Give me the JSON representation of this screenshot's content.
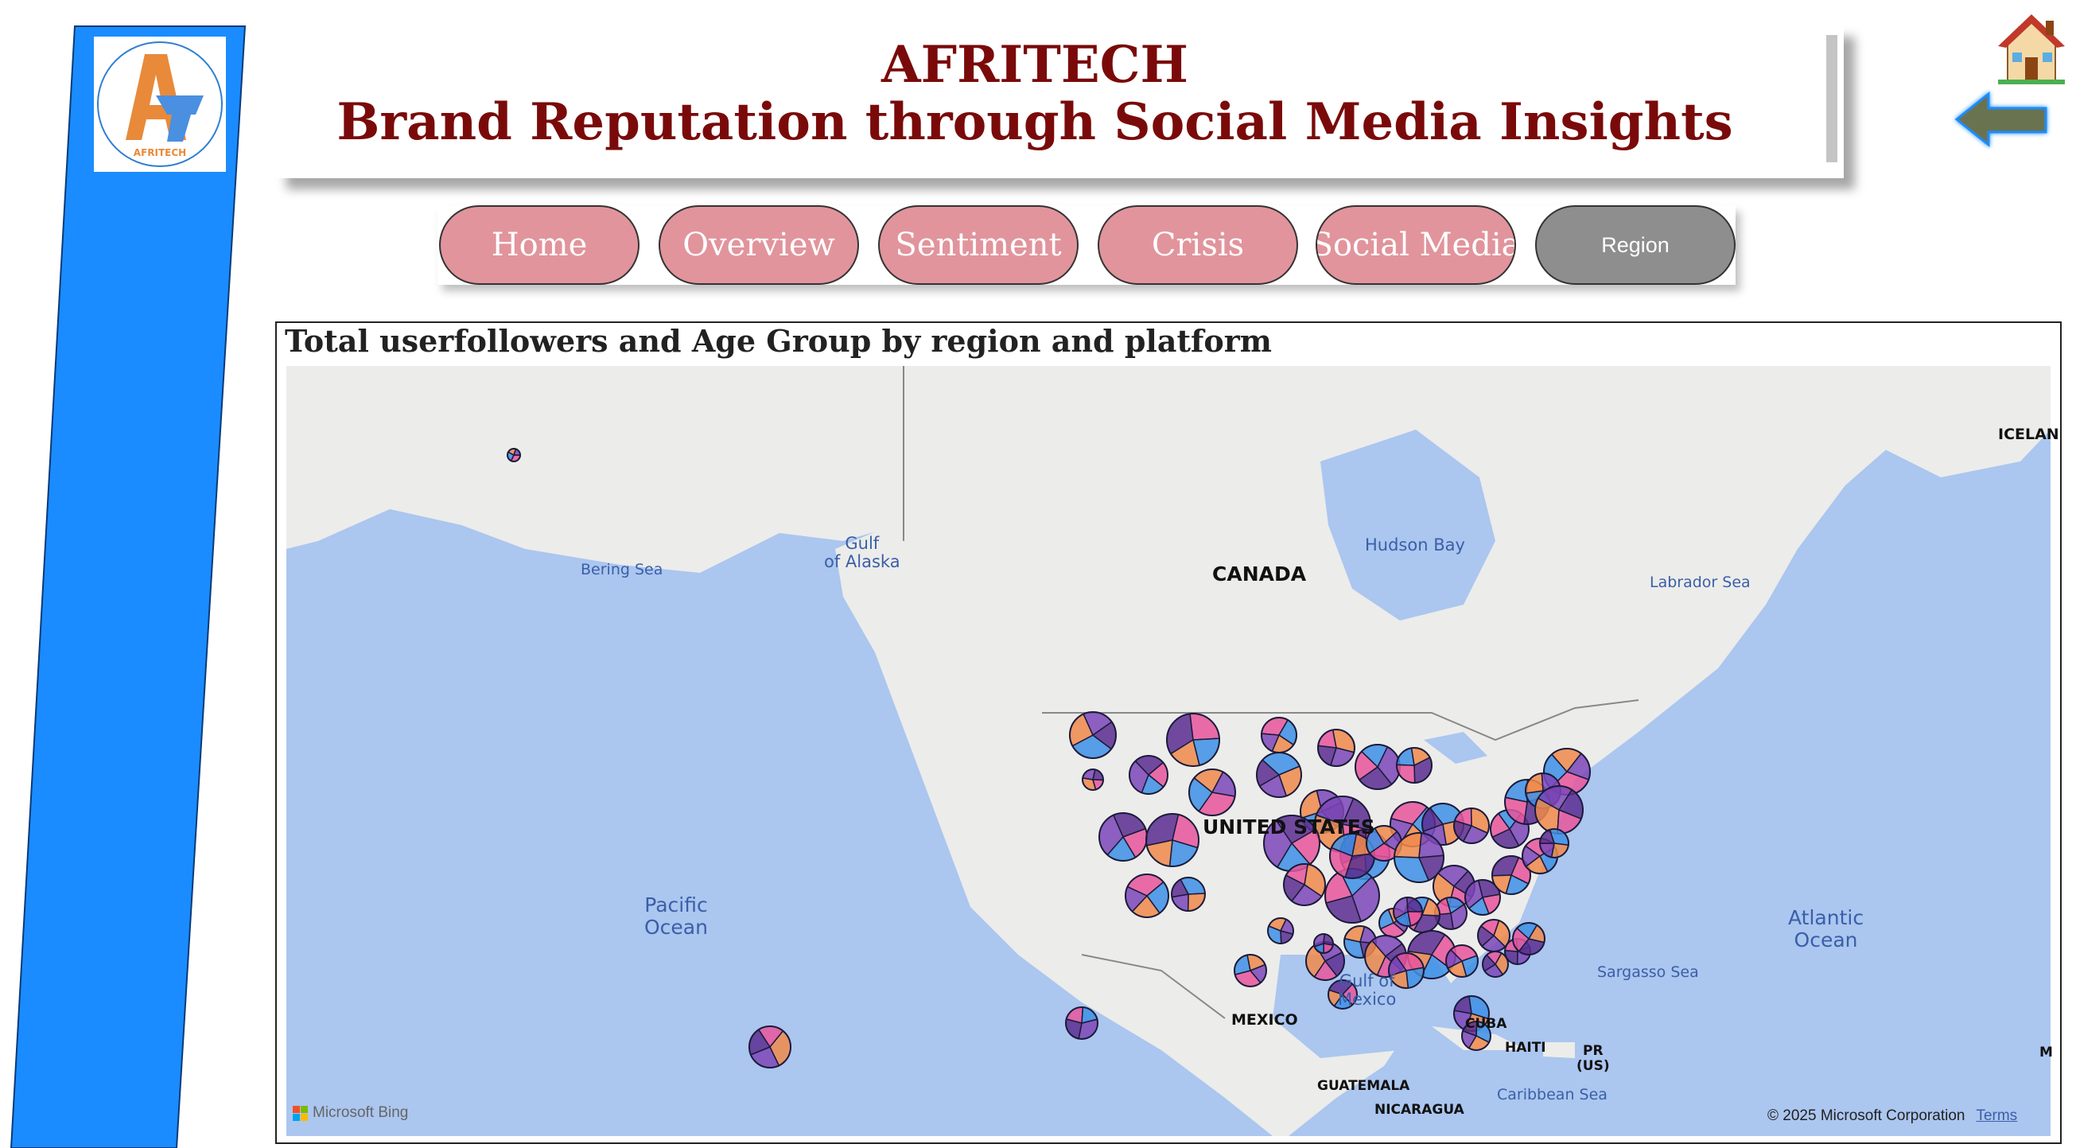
{
  "header": {
    "title_line1": "AFRITECH",
    "title_line2": "Brand Reputation through Social Media Insights"
  },
  "logo": {
    "text": "AFRITECH"
  },
  "nav": {
    "home": "Home",
    "overview": "Overview",
    "sentiment": "Sentiment",
    "crisis": "Crisis",
    "social_media": "Social Media",
    "region": "Region",
    "active": "Region"
  },
  "icons": {
    "home": "house-icon",
    "back": "back-arrow-icon"
  },
  "visual": {
    "title": "Total userfollowers and Age Group by region and platform",
    "map_labels": {
      "canada": "CANADA",
      "united_states": "UNITED STATES",
      "mexico": "MEXICO",
      "cuba": "CUBA",
      "haiti": "HAITI",
      "pr_line1": "PR",
      "pr_line2": "(US)",
      "guatemala": "GUATEMALA",
      "nicaragua": "NICARAGUA",
      "iceland": "ICELAN",
      "m_edge": "M",
      "hudson_bay": "Hudson Bay",
      "labrador_sea": "Labrador Sea",
      "bering_sea": "Bering Sea",
      "gulf_alaska_1": "Gulf",
      "gulf_alaska_2": "of Alaska",
      "pacific_1": "Pacific",
      "pacific_2": "Ocean",
      "atlantic_1": "Atlantic",
      "atlantic_2": "Ocean",
      "gulf_mexico_1": "Gulf of",
      "gulf_mexico_2": "Mexico",
      "sargasso": "Sargasso Sea",
      "caribbean": "Caribbean Sea"
    },
    "attribution": {
      "bing": "Microsoft Bing",
      "copyright": "© 2025 Microsoft Corporation",
      "terms": "Terms"
    }
  },
  "colors": {
    "sidebar": "#1a8cff",
    "title": "#7a0a0a",
    "nav_inactive": "#e1949c",
    "nav_active": "#8e8e8e",
    "water": "#abc6ef",
    "land": "#ececea",
    "pie_colors": [
      "#e8559c",
      "#3d8fe6",
      "#f08a4b",
      "#7d47b8",
      "#5a2d91"
    ]
  }
}
